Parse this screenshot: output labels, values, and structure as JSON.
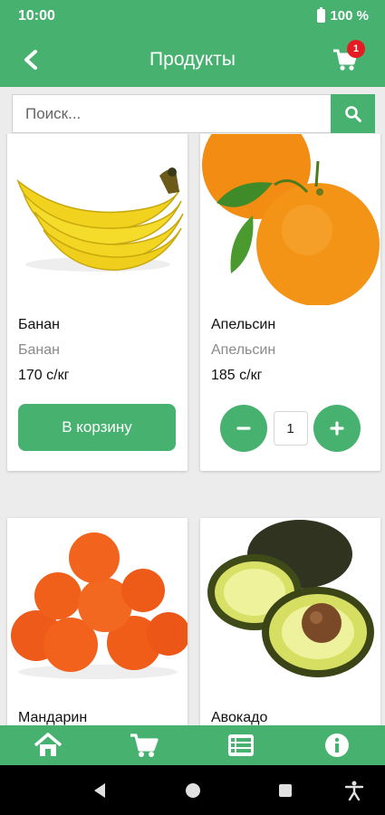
{
  "status_bar": {
    "time": "10:00",
    "battery": "100 %"
  },
  "app_bar": {
    "title": "Продукты",
    "cart_count": "1"
  },
  "search": {
    "placeholder": "Поиск..."
  },
  "products": [
    {
      "name": "Банан",
      "subtitle": "Банан",
      "price": "170 с/кг",
      "button_label": "В корзину"
    },
    {
      "name": "Апельсин",
      "subtitle": "Апельсин",
      "price": "185 с/кг",
      "quantity": "1"
    },
    {
      "name": "Мандарин"
    },
    {
      "name": "Авокадо"
    }
  ],
  "colors": {
    "primary": "#47b26f",
    "badge": "#e51c23"
  },
  "icons": {
    "back": "back-arrow-icon",
    "cart": "cart-icon",
    "search": "search-icon",
    "nav": [
      "home-icon",
      "cart-icon",
      "list-icon",
      "info-icon"
    ],
    "system": [
      "back-triangle-icon",
      "home-circle-icon",
      "recents-square-icon",
      "accessibility-icon"
    ]
  }
}
